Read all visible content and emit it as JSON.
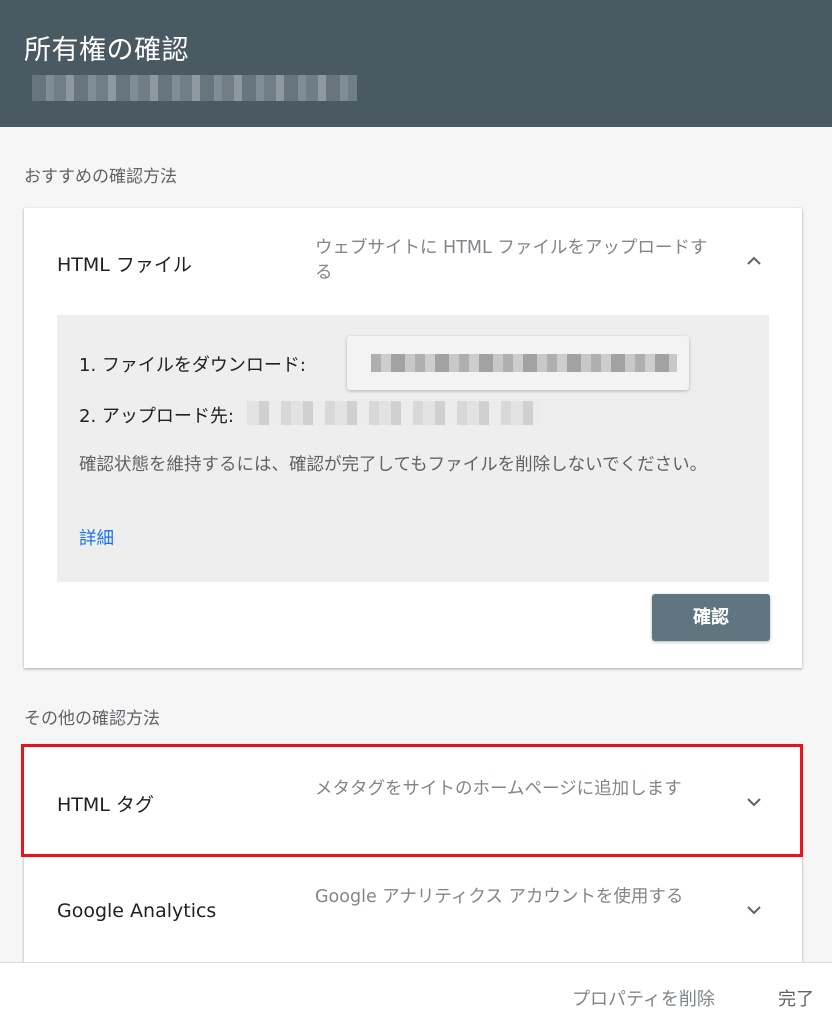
{
  "header": {
    "title": "所有権の確認"
  },
  "recommended": {
    "section_label": "おすすめの確認方法",
    "method": {
      "name": "HTML ファイル",
      "description": "ウェブサイトに HTML ファイルをアップロードする",
      "steps": {
        "download_label": "1. ファイルをダウンロード:",
        "upload_label": "2. アップロード先:"
      },
      "note": "確認状態を維持するには、確認が完了してもファイルを削除しないでください。",
      "details_link": "詳細",
      "verify_button": "確認"
    }
  },
  "other": {
    "section_label": "その他の確認方法",
    "methods": [
      {
        "name": "HTML タグ",
        "description": "メタタグをサイトのホームページに追加します"
      },
      {
        "name": "Google Analytics",
        "description": "Google アナリティクス アカウントを使用する"
      }
    ]
  },
  "footer": {
    "delete_property": "プロパティを削除",
    "done": "完了"
  },
  "colors": {
    "header_bg": "#4a5a63",
    "button_bg": "#5f7681",
    "link": "#1a73e8",
    "highlight": "#e8141c"
  }
}
